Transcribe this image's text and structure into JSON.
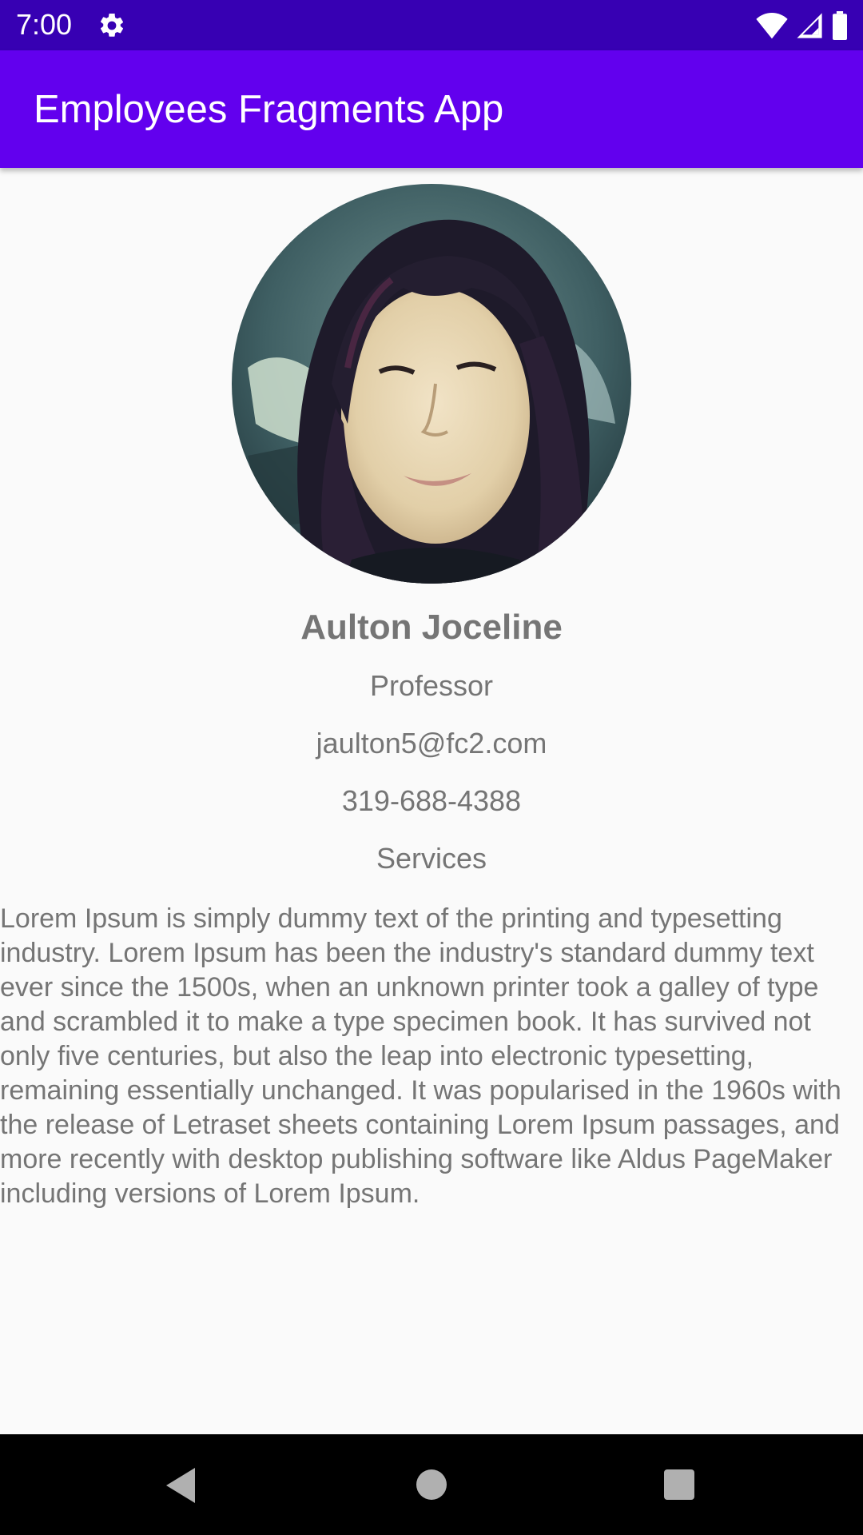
{
  "status_bar": {
    "time": "7:00",
    "icons": [
      "gear-icon",
      "wifi-icon",
      "signal-icon",
      "battery-icon"
    ]
  },
  "app_bar": {
    "title": "Employees Fragments App"
  },
  "employee": {
    "avatar_icon": "employee-photo",
    "name": "Aulton Joceline",
    "job_title": "Professor",
    "email": "jaulton5@fc2.com",
    "phone": "319-688-4388",
    "department": "Services",
    "bio": "Lorem Ipsum is simply dummy text of the printing and typesetting industry. Lorem Ipsum has been the industry's standard dummy text ever since the 1500s, when an unknown printer took a galley of type and scrambled it to make a type specimen book. It has survived not only five centuries, but also the leap into electronic typesetting, remaining essentially unchanged. It was popularised in the 1960s with the release of Letraset sheets containing Lorem Ipsum passages, and more recently with desktop publishing software like Aldus PageMaker including versions of Lorem Ipsum."
  },
  "nav_bar": {
    "icons": [
      "back-icon",
      "home-icon",
      "recents-icon"
    ]
  },
  "colors": {
    "status_bar": "#3700b3",
    "app_bar": "#6200ee",
    "background": "#fafafa",
    "text_secondary": "#757575",
    "nav_bar": "#000000"
  }
}
